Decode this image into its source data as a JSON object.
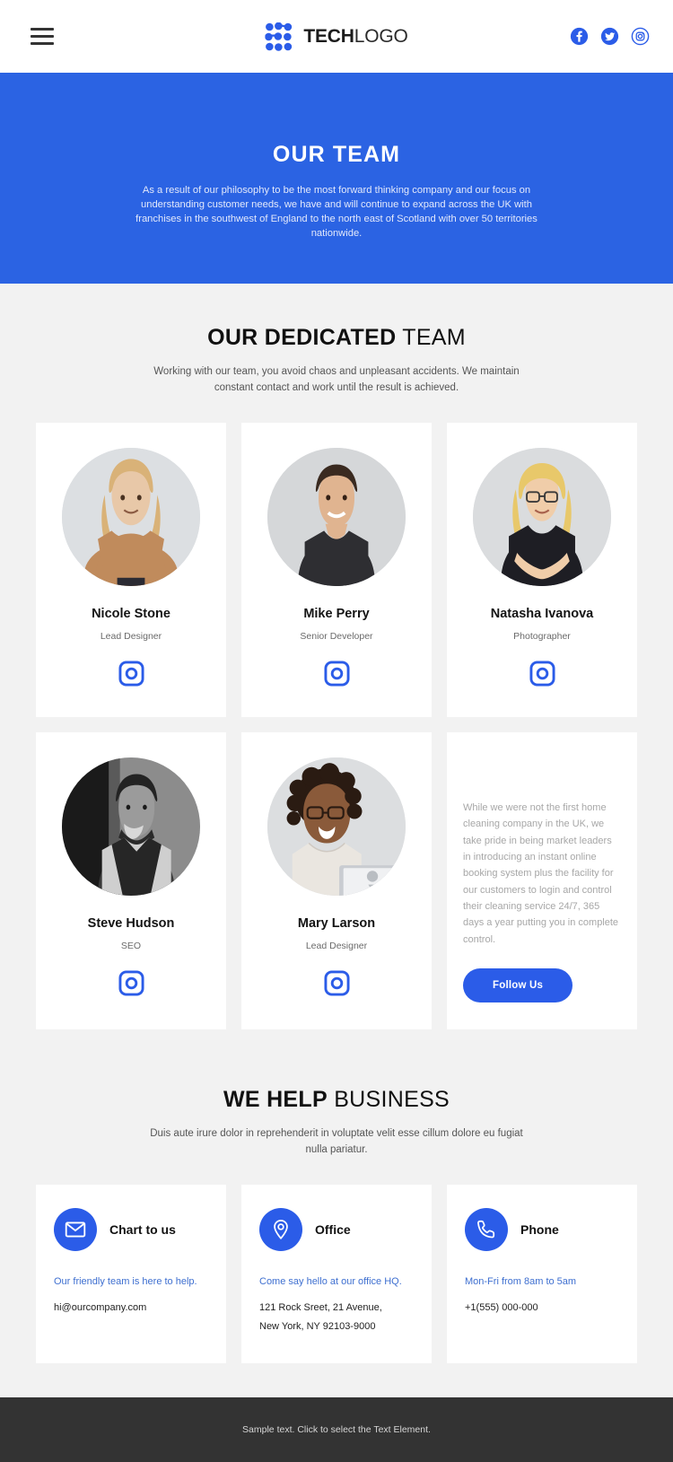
{
  "header": {
    "menu_icon": "hamburger-icon",
    "logo": {
      "bold": "TECH",
      "light": "LOGO",
      "mark": "dot-grid-icon"
    },
    "socials": [
      {
        "name": "facebook-icon",
        "label": "Facebook"
      },
      {
        "name": "twitter-icon",
        "label": "Twitter"
      },
      {
        "name": "instagram-icon",
        "label": "Instagram"
      }
    ]
  },
  "hero": {
    "title": "OUR TEAM",
    "subtitle": "As a result of our philosophy to be the most forward thinking company and our focus on understanding customer needs, we have and will continue to expand across the UK with franchises in the southwest of England to the north east of Scotland with over 50 territories nationwide.",
    "bg_color": "#2b63e3"
  },
  "team_section": {
    "title_bold": "OUR DEDICATED",
    "title_light": " TEAM",
    "subtitle": "Working with our team, you avoid chaos and unpleasant accidents. We maintain constant contact and work until the result is achieved.",
    "members": [
      {
        "name": "Nicole Stone",
        "role": "Lead Designer",
        "social": "instagram-icon"
      },
      {
        "name": "Mike Perry",
        "role": "Senior Developer",
        "social": "instagram-icon"
      },
      {
        "name": "Natasha Ivanova",
        "role": "Photographer",
        "social": "instagram-icon"
      },
      {
        "name": "Steve Hudson",
        "role": "SEO",
        "social": "instagram-icon"
      },
      {
        "name": "Mary Larson",
        "role": "Lead Designer",
        "social": "instagram-icon"
      }
    ],
    "text_card": {
      "body": "While we were not the first home cleaning company in the UK, we take pride in being market leaders in introducing an instant online booking system plus the facility for our customers to login and control their cleaning service 24/7, 365 days a year putting you in complete control.",
      "button_label": "Follow Us",
      "button_color": "#2b5ce8"
    }
  },
  "business_section": {
    "title_bold": "WE HELP",
    "title_light": " BUSINESS",
    "subtitle": "Duis aute irure dolor in reprehenderit in voluptate velit esse cillum dolore eu fugiat nulla pariatur.",
    "cards": [
      {
        "icon": "envelope-icon",
        "title": "Chart to us",
        "line1": "Our friendly team is here to help.",
        "lines": [
          "hi@ourcompany.com"
        ]
      },
      {
        "icon": "map-pin-icon",
        "title": "Office",
        "line1": "Come say hello at our office HQ.",
        "lines": [
          "121 Rock Sreet, 21 Avenue,",
          "New York, NY 92103-9000"
        ]
      },
      {
        "icon": "phone-icon",
        "title": "Phone",
        "line1": "Mon-Fri from 8am to 5am",
        "lines": [
          "+1(555) 000-000"
        ]
      }
    ]
  },
  "footer": {
    "text": "Sample text. Click to select the Text Element.",
    "bg_color": "#333333"
  }
}
